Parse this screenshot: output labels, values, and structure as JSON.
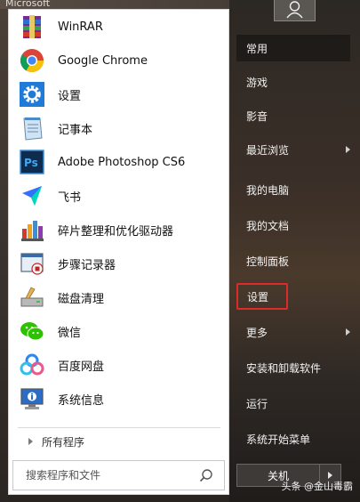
{
  "background": {
    "top_text": "Microsoft"
  },
  "apps": [
    {
      "label": "WinRAR",
      "icon": "winrar-icon"
    },
    {
      "label": "Google Chrome",
      "icon": "chrome-icon"
    },
    {
      "label": "设置",
      "icon": "settings-gear-icon"
    },
    {
      "label": "记事本",
      "icon": "notepad-icon"
    },
    {
      "label": "Adobe Photoshop CS6",
      "icon": "photoshop-icon"
    },
    {
      "label": "飞书",
      "icon": "feishu-icon"
    },
    {
      "label": "碎片整理和优化驱动器",
      "icon": "defrag-icon"
    },
    {
      "label": "步骤记录器",
      "icon": "steps-recorder-icon"
    },
    {
      "label": "磁盘清理",
      "icon": "disk-cleanup-icon"
    },
    {
      "label": "微信",
      "icon": "wechat-icon"
    },
    {
      "label": "百度网盘",
      "icon": "baidu-netdisk-icon"
    },
    {
      "label": "系统信息",
      "icon": "system-info-icon"
    }
  ],
  "all_programs": "所有程序",
  "search": {
    "placeholder": "搜索程序和文件"
  },
  "right_menu": [
    {
      "label": "常用",
      "active": true
    },
    {
      "label": "游戏"
    },
    {
      "label": "影音"
    },
    {
      "label": "最近浏览",
      "submenu": true
    },
    {
      "label": "我的电脑"
    },
    {
      "label": "我的文档"
    },
    {
      "label": "控制面板"
    },
    {
      "label": "设置",
      "highlight": true
    },
    {
      "label": "更多",
      "submenu": true
    },
    {
      "label": "安装和卸载软件"
    },
    {
      "label": "运行"
    },
    {
      "label": "系统开始菜单"
    }
  ],
  "shutdown": {
    "label": "关机"
  },
  "watermark": "头条 @金山毒霸",
  "colors": {
    "highlight_border": "#e02a2a",
    "accent_blue": "#1f7ad8"
  }
}
